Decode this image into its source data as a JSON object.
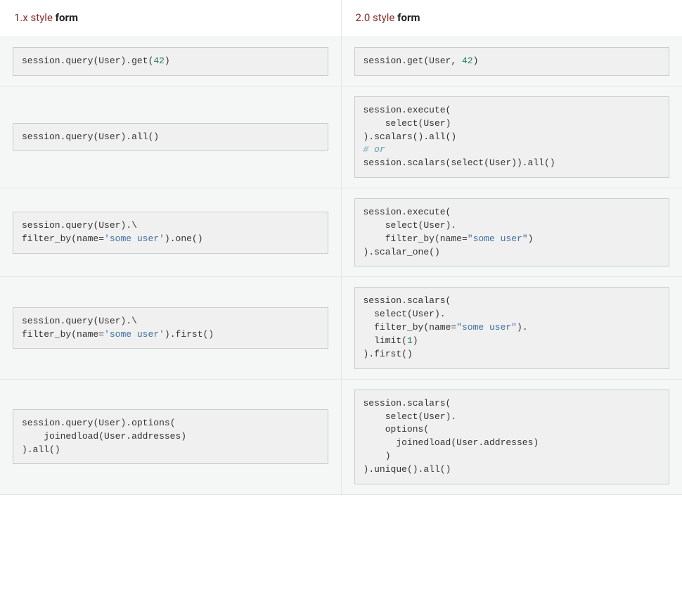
{
  "headers": {
    "col1": {
      "prefix": "1.x style ",
      "suffix": "form"
    },
    "col2": {
      "prefix": "2.0 style ",
      "suffix": "form"
    }
  },
  "rows": [
    {
      "left": [
        [
          {
            "t": "n",
            "v": "session"
          },
          {
            "t": "p",
            "v": "."
          },
          {
            "t": "n",
            "v": "query"
          },
          {
            "t": "p",
            "v": "("
          },
          {
            "t": "n",
            "v": "User"
          },
          {
            "t": "p",
            "v": ")"
          },
          {
            "t": "p",
            "v": "."
          },
          {
            "t": "n",
            "v": "get"
          },
          {
            "t": "p",
            "v": "("
          },
          {
            "t": "num",
            "v": "42"
          },
          {
            "t": "p",
            "v": ")"
          }
        ]
      ],
      "right": [
        [
          {
            "t": "n",
            "v": "session"
          },
          {
            "t": "p",
            "v": "."
          },
          {
            "t": "n",
            "v": "get"
          },
          {
            "t": "p",
            "v": "("
          },
          {
            "t": "n",
            "v": "User"
          },
          {
            "t": "p",
            "v": ", "
          },
          {
            "t": "num",
            "v": "42"
          },
          {
            "t": "p",
            "v": ")"
          }
        ]
      ]
    },
    {
      "left": [
        [
          {
            "t": "n",
            "v": "session"
          },
          {
            "t": "p",
            "v": "."
          },
          {
            "t": "n",
            "v": "query"
          },
          {
            "t": "p",
            "v": "("
          },
          {
            "t": "n",
            "v": "User"
          },
          {
            "t": "p",
            "v": ")"
          },
          {
            "t": "p",
            "v": "."
          },
          {
            "t": "n",
            "v": "all"
          },
          {
            "t": "p",
            "v": "()"
          }
        ]
      ],
      "right": [
        [
          {
            "t": "n",
            "v": "session"
          },
          {
            "t": "p",
            "v": "."
          },
          {
            "t": "n",
            "v": "execute"
          },
          {
            "t": "p",
            "v": "("
          }
        ],
        [
          {
            "t": "p",
            "v": "    "
          },
          {
            "t": "n",
            "v": "select"
          },
          {
            "t": "p",
            "v": "("
          },
          {
            "t": "n",
            "v": "User"
          },
          {
            "t": "p",
            "v": ")"
          }
        ],
        [
          {
            "t": "p",
            "v": ")"
          },
          {
            "t": "p",
            "v": "."
          },
          {
            "t": "n",
            "v": "scalars"
          },
          {
            "t": "p",
            "v": "()"
          },
          {
            "t": "p",
            "v": "."
          },
          {
            "t": "n",
            "v": "all"
          },
          {
            "t": "p",
            "v": "()"
          }
        ],
        [
          {
            "t": "cm",
            "v": "# or"
          }
        ],
        [
          {
            "t": "n",
            "v": "session"
          },
          {
            "t": "p",
            "v": "."
          },
          {
            "t": "n",
            "v": "scalars"
          },
          {
            "t": "p",
            "v": "("
          },
          {
            "t": "n",
            "v": "select"
          },
          {
            "t": "p",
            "v": "("
          },
          {
            "t": "n",
            "v": "User"
          },
          {
            "t": "p",
            "v": "))"
          },
          {
            "t": "p",
            "v": "."
          },
          {
            "t": "n",
            "v": "all"
          },
          {
            "t": "p",
            "v": "()"
          }
        ]
      ]
    },
    {
      "left": [
        [
          {
            "t": "n",
            "v": "session"
          },
          {
            "t": "p",
            "v": "."
          },
          {
            "t": "n",
            "v": "query"
          },
          {
            "t": "p",
            "v": "("
          },
          {
            "t": "n",
            "v": "User"
          },
          {
            "t": "p",
            "v": ")"
          },
          {
            "t": "p",
            "v": "."
          },
          {
            "t": "p",
            "v": "\\"
          }
        ],
        [
          {
            "t": "n",
            "v": "filter_by"
          },
          {
            "t": "p",
            "v": "("
          },
          {
            "t": "n",
            "v": "name"
          },
          {
            "t": "p",
            "v": "="
          },
          {
            "t": "str",
            "v": "'some user'"
          },
          {
            "t": "p",
            "v": ")"
          },
          {
            "t": "p",
            "v": "."
          },
          {
            "t": "n",
            "v": "one"
          },
          {
            "t": "p",
            "v": "()"
          }
        ]
      ],
      "right": [
        [
          {
            "t": "n",
            "v": "session"
          },
          {
            "t": "p",
            "v": "."
          },
          {
            "t": "n",
            "v": "execute"
          },
          {
            "t": "p",
            "v": "("
          }
        ],
        [
          {
            "t": "p",
            "v": "    "
          },
          {
            "t": "n",
            "v": "select"
          },
          {
            "t": "p",
            "v": "("
          },
          {
            "t": "n",
            "v": "User"
          },
          {
            "t": "p",
            "v": ")"
          },
          {
            "t": "p",
            "v": "."
          }
        ],
        [
          {
            "t": "p",
            "v": "    "
          },
          {
            "t": "n",
            "v": "filter_by"
          },
          {
            "t": "p",
            "v": "("
          },
          {
            "t": "n",
            "v": "name"
          },
          {
            "t": "p",
            "v": "="
          },
          {
            "t": "str",
            "v": "\"some user\""
          },
          {
            "t": "p",
            "v": ")"
          }
        ],
        [
          {
            "t": "p",
            "v": ")"
          },
          {
            "t": "p",
            "v": "."
          },
          {
            "t": "n",
            "v": "scalar_one"
          },
          {
            "t": "p",
            "v": "()"
          }
        ]
      ]
    },
    {
      "left": [
        [
          {
            "t": "n",
            "v": "session"
          },
          {
            "t": "p",
            "v": "."
          },
          {
            "t": "n",
            "v": "query"
          },
          {
            "t": "p",
            "v": "("
          },
          {
            "t": "n",
            "v": "User"
          },
          {
            "t": "p",
            "v": ")"
          },
          {
            "t": "p",
            "v": "."
          },
          {
            "t": "p",
            "v": "\\"
          }
        ],
        [
          {
            "t": "n",
            "v": "filter_by"
          },
          {
            "t": "p",
            "v": "("
          },
          {
            "t": "n",
            "v": "name"
          },
          {
            "t": "p",
            "v": "="
          },
          {
            "t": "str",
            "v": "'some user'"
          },
          {
            "t": "p",
            "v": ")"
          },
          {
            "t": "p",
            "v": "."
          },
          {
            "t": "n",
            "v": "first"
          },
          {
            "t": "p",
            "v": "()"
          }
        ]
      ],
      "right": [
        [
          {
            "t": "n",
            "v": "session"
          },
          {
            "t": "p",
            "v": "."
          },
          {
            "t": "n",
            "v": "scalars"
          },
          {
            "t": "p",
            "v": "("
          }
        ],
        [
          {
            "t": "p",
            "v": "  "
          },
          {
            "t": "n",
            "v": "select"
          },
          {
            "t": "p",
            "v": "("
          },
          {
            "t": "n",
            "v": "User"
          },
          {
            "t": "p",
            "v": ")"
          },
          {
            "t": "p",
            "v": "."
          }
        ],
        [
          {
            "t": "p",
            "v": "  "
          },
          {
            "t": "n",
            "v": "filter_by"
          },
          {
            "t": "p",
            "v": "("
          },
          {
            "t": "n",
            "v": "name"
          },
          {
            "t": "p",
            "v": "="
          },
          {
            "t": "str",
            "v": "\"some user\""
          },
          {
            "t": "p",
            "v": ")"
          },
          {
            "t": "p",
            "v": "."
          }
        ],
        [
          {
            "t": "p",
            "v": "  "
          },
          {
            "t": "n",
            "v": "limit"
          },
          {
            "t": "p",
            "v": "("
          },
          {
            "t": "num",
            "v": "1"
          },
          {
            "t": "p",
            "v": ")"
          }
        ],
        [
          {
            "t": "p",
            "v": ")"
          },
          {
            "t": "p",
            "v": "."
          },
          {
            "t": "n",
            "v": "first"
          },
          {
            "t": "p",
            "v": "()"
          }
        ]
      ]
    },
    {
      "left": [
        [
          {
            "t": "n",
            "v": "session"
          },
          {
            "t": "p",
            "v": "."
          },
          {
            "t": "n",
            "v": "query"
          },
          {
            "t": "p",
            "v": "("
          },
          {
            "t": "n",
            "v": "User"
          },
          {
            "t": "p",
            "v": ")"
          },
          {
            "t": "p",
            "v": "."
          },
          {
            "t": "n",
            "v": "options"
          },
          {
            "t": "p",
            "v": "("
          }
        ],
        [
          {
            "t": "p",
            "v": "    "
          },
          {
            "t": "n",
            "v": "joinedload"
          },
          {
            "t": "p",
            "v": "("
          },
          {
            "t": "n",
            "v": "User"
          },
          {
            "t": "p",
            "v": "."
          },
          {
            "t": "n",
            "v": "addresses"
          },
          {
            "t": "p",
            "v": ")"
          }
        ],
        [
          {
            "t": "p",
            "v": ")"
          },
          {
            "t": "p",
            "v": "."
          },
          {
            "t": "n",
            "v": "all"
          },
          {
            "t": "p",
            "v": "()"
          }
        ]
      ],
      "right": [
        [
          {
            "t": "n",
            "v": "session"
          },
          {
            "t": "p",
            "v": "."
          },
          {
            "t": "n",
            "v": "scalars"
          },
          {
            "t": "p",
            "v": "("
          }
        ],
        [
          {
            "t": "p",
            "v": "    "
          },
          {
            "t": "n",
            "v": "select"
          },
          {
            "t": "p",
            "v": "("
          },
          {
            "t": "n",
            "v": "User"
          },
          {
            "t": "p",
            "v": ")"
          },
          {
            "t": "p",
            "v": "."
          }
        ],
        [
          {
            "t": "p",
            "v": "    "
          },
          {
            "t": "n",
            "v": "options"
          },
          {
            "t": "p",
            "v": "("
          }
        ],
        [
          {
            "t": "p",
            "v": "      "
          },
          {
            "t": "n",
            "v": "joinedload"
          },
          {
            "t": "p",
            "v": "("
          },
          {
            "t": "n",
            "v": "User"
          },
          {
            "t": "p",
            "v": "."
          },
          {
            "t": "n",
            "v": "addresses"
          },
          {
            "t": "p",
            "v": ")"
          }
        ],
        [
          {
            "t": "p",
            "v": "    "
          },
          {
            "t": "p",
            "v": ")"
          }
        ],
        [
          {
            "t": "p",
            "v": ")"
          },
          {
            "t": "p",
            "v": "."
          },
          {
            "t": "n",
            "v": "unique"
          },
          {
            "t": "p",
            "v": "()"
          },
          {
            "t": "p",
            "v": "."
          },
          {
            "t": "n",
            "v": "all"
          },
          {
            "t": "p",
            "v": "()"
          }
        ]
      ]
    }
  ]
}
